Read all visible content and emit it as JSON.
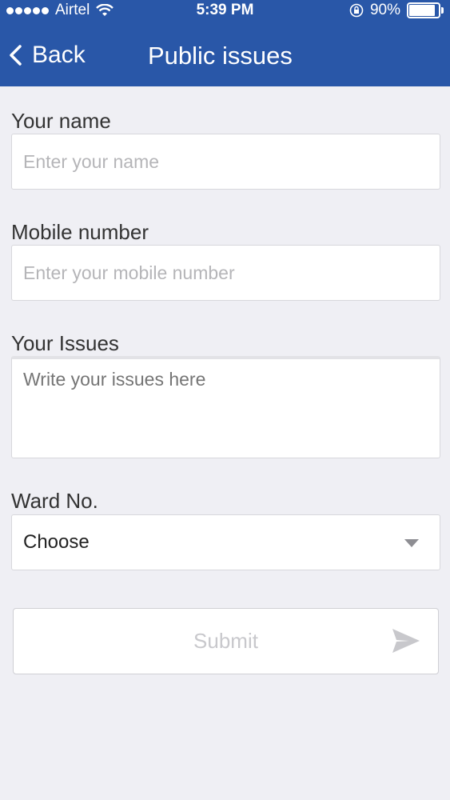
{
  "status_bar": {
    "carrier": "Airtel",
    "time": "5:39 PM",
    "battery": "90%",
    "battery_level": 0.9
  },
  "nav": {
    "back_label": "Back",
    "title": "Public issues"
  },
  "form": {
    "name": {
      "label": "Your name",
      "placeholder": "Enter your name"
    },
    "mobile": {
      "label": "Mobile number",
      "placeholder": "Enter your mobile number"
    },
    "issues": {
      "label": "Your Issues",
      "placeholder": "Write your issues here"
    },
    "ward": {
      "label": "Ward No.",
      "selected": "Choose"
    },
    "submit_label": "Submit"
  },
  "colors": {
    "header_bg": "#2957a8",
    "page_bg": "#efeff4",
    "placeholder": "#b5b5b8",
    "submit_text": "#c8c8cc"
  },
  "icons": [
    "signal-icon",
    "wifi-icon",
    "orientation-lock-icon",
    "battery-icon",
    "chevron-left-icon",
    "chevron-down-icon",
    "send-icon"
  ]
}
